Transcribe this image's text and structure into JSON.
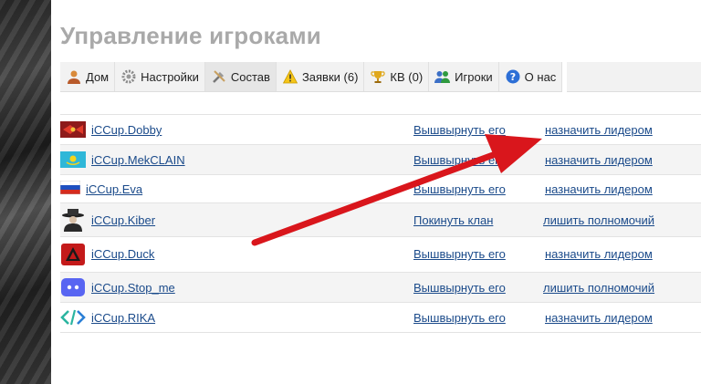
{
  "page": {
    "title": "Управление игроками"
  },
  "tabs": [
    {
      "label": "Дом",
      "icon": "user-icon"
    },
    {
      "label": "Настройки",
      "icon": "gear-icon"
    },
    {
      "label": "Состав",
      "icon": "tools-icon"
    },
    {
      "label": "Заявки (6)",
      "icon": "warning-icon"
    },
    {
      "label": "КВ (0)",
      "icon": "trophy-icon"
    },
    {
      "label": "Игроки",
      "icon": "users-icon"
    },
    {
      "label": "О нас",
      "icon": "help-icon"
    }
  ],
  "players": [
    {
      "name": "iCCup.Dobby",
      "action1": "Вышвырнуть его",
      "action2": "назначить лидером",
      "icon": "red-banner-icon"
    },
    {
      "name": "iCCup.MekCLAIN",
      "action1": "Вышвырнуть его",
      "action2": "назначить лидером",
      "icon": "kazakhstan-flag-icon"
    },
    {
      "name": "iCCup.Eva",
      "action1": "Вышвырнуть его",
      "action2": "назначить лидером",
      "icon": "russia-flag-icon"
    },
    {
      "name": "iCCup.Kiber",
      "action1": "Покинуть клан",
      "action2": "лишить полномочий",
      "icon": "hat-man-icon"
    },
    {
      "name": "iCCup.Duck",
      "action1": "Вышвырнуть его",
      "action2": "назначить лидером",
      "icon": "red-emblem-icon"
    },
    {
      "name": "iCCup.Stop_me",
      "action1": "Вышвырнуть его",
      "action2": "лишить полномочий",
      "icon": "discord-icon"
    },
    {
      "name": "iCCup.RIKA",
      "action1": "Вышвырнуть его",
      "action2": "назначить лидером",
      "icon": "code-brackets-icon"
    }
  ],
  "colors": {
    "link": "#1a4a8a",
    "arrow": "#d9161c",
    "title": "#a9a9a9"
  }
}
